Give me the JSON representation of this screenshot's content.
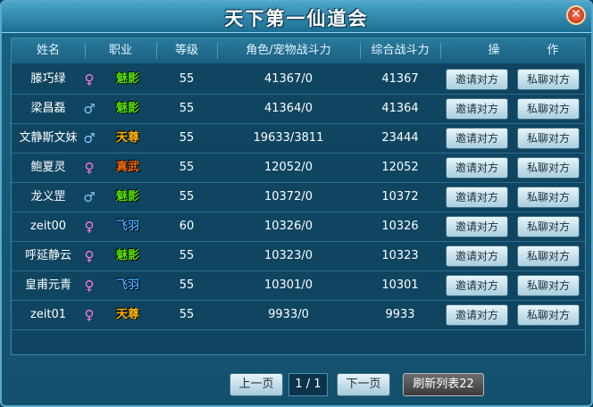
{
  "window": {
    "title": "天下第一仙道会"
  },
  "table": {
    "headers": {
      "name": "姓名",
      "class": "职业",
      "level": "等级",
      "power": "角色/宠物战斗力",
      "total": "综合战斗力",
      "op1": "操",
      "op2": "作"
    },
    "rows": [
      {
        "name": "滕巧绿",
        "gender": "female",
        "gender_icon": "♀",
        "class": "魅影",
        "class_color": "#57e000",
        "level": "55",
        "power": "41367/0",
        "total": "41367",
        "invite": "邀请对方",
        "chat": "私聊对方"
      },
      {
        "name": "梁昌磊",
        "gender": "male",
        "gender_icon": "♂",
        "class": "魅影",
        "class_color": "#57e000",
        "level": "55",
        "power": "41364/0",
        "total": "41364",
        "invite": "邀请对方",
        "chat": "私聊对方"
      },
      {
        "name": "文静斯文妹",
        "gender": "male",
        "gender_icon": "♂",
        "class": "天尊",
        "class_color": "#ffb400",
        "level": "55",
        "power": "19633/3811",
        "total": "23444",
        "invite": "邀请对方",
        "chat": "私聊对方"
      },
      {
        "name": "鲍夏灵",
        "gender": "female",
        "gender_icon": "♀",
        "class": "真武",
        "class_color": "#ff6a00",
        "level": "55",
        "power": "12052/0",
        "total": "12052",
        "invite": "邀请对方",
        "chat": "私聊对方"
      },
      {
        "name": "龙义罡",
        "gender": "male",
        "gender_icon": "♂",
        "class": "魅影",
        "class_color": "#57e000",
        "level": "55",
        "power": "10372/0",
        "total": "10372",
        "invite": "邀请对方",
        "chat": "私聊对方"
      },
      {
        "name": "zeit00",
        "gender": "female",
        "gender_icon": "♀",
        "class": "飞羽",
        "class_color": "#3da7ff",
        "level": "60",
        "power": "10326/0",
        "total": "10326",
        "invite": "邀请对方",
        "chat": "私聊对方"
      },
      {
        "name": "呼延静云",
        "gender": "female",
        "gender_icon": "♀",
        "class": "魅影",
        "class_color": "#57e000",
        "level": "55",
        "power": "10323/0",
        "total": "10323",
        "invite": "邀请对方",
        "chat": "私聊对方"
      },
      {
        "name": "皇甫元青",
        "gender": "female",
        "gender_icon": "♀",
        "class": "飞羽",
        "class_color": "#3da7ff",
        "level": "55",
        "power": "10301/0",
        "total": "10301",
        "invite": "邀请对方",
        "chat": "私聊对方"
      },
      {
        "name": "zeit01",
        "gender": "female",
        "gender_icon": "♀",
        "class": "天尊",
        "class_color": "#ffb400",
        "level": "55",
        "power": "9933/0",
        "total": "9933",
        "invite": "邀请对方",
        "chat": "私聊对方"
      }
    ]
  },
  "footer": {
    "prev": "上一页",
    "page": "1 / 1",
    "next": "下一页",
    "refresh": "刷新列表22"
  }
}
